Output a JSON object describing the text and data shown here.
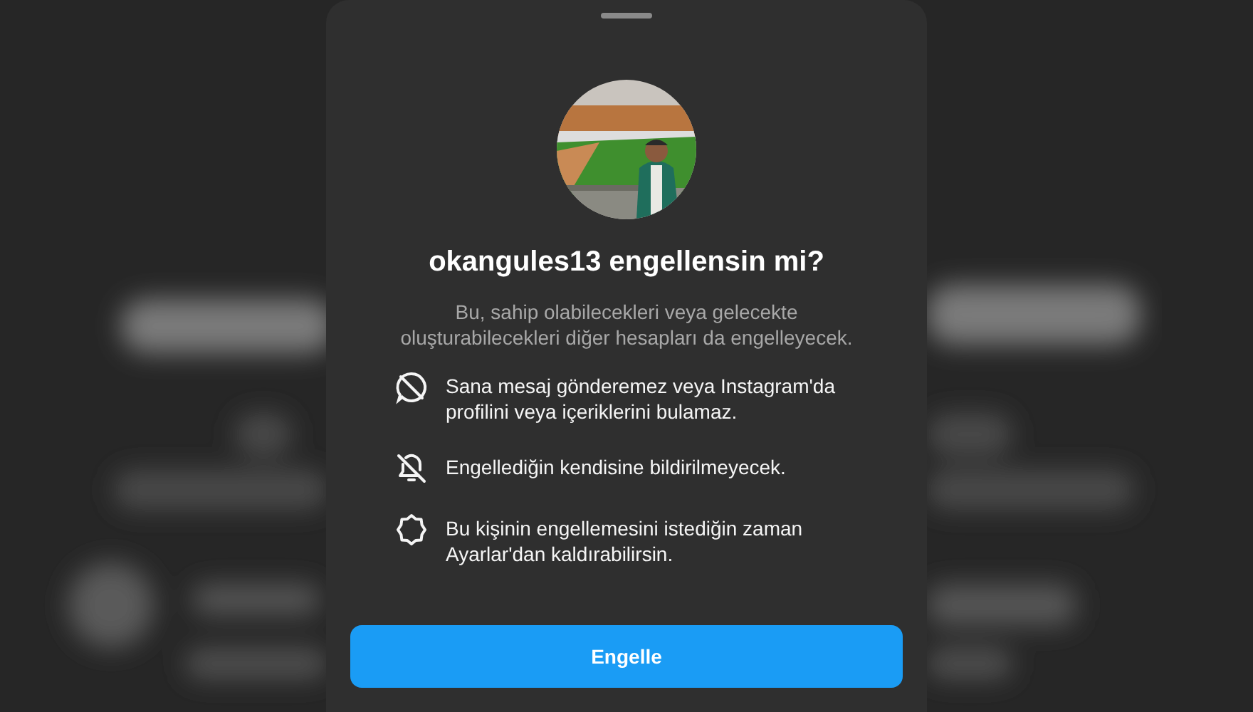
{
  "sheet": {
    "title": "okangules13 engellensin mi?",
    "subtitle": "Bu, sahip olabilecekleri veya gelecekte\noluşturabilecekleri diğer hesapları da engelleyecek.",
    "items": [
      {
        "kind": "message-off",
        "text": "Sana mesaj gönderemez veya Instagram'da profilini veya içeriklerini bulamaz."
      },
      {
        "kind": "bell-off",
        "text": "Engellediğin kendisine bildirilmeyecek."
      },
      {
        "kind": "settings",
        "text": "Bu kişinin engellemesini istediğin zaman Ayarlar'dan kaldırabilirsin."
      }
    ],
    "button": "Engelle"
  }
}
